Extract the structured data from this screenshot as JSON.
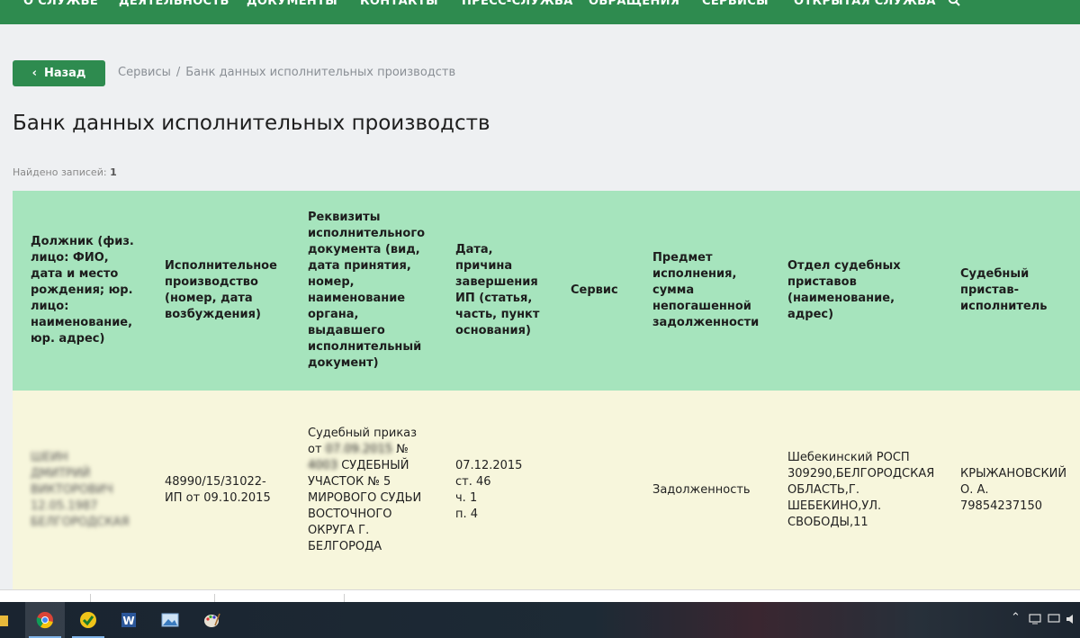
{
  "nav": {
    "items": [
      "О СЛУЖБЕ",
      "ДЕЯТЕЛЬНОСТЬ",
      "ДОКУМЕНТЫ",
      "КОНТАКТЫ",
      "ПРЕСС-СЛУЖБА",
      "ОБРАЩЕНИЯ",
      "СЕРВИСЫ",
      "ОТКРЫТАЯ СЛУЖБА"
    ],
    "search_icon": "search-icon"
  },
  "back_button": {
    "label": "Назад",
    "icon": "chevron-left-icon"
  },
  "breadcrumb": {
    "items": [
      "Сервисы",
      "Банк данных исполнительных производств"
    ],
    "separator": "/"
  },
  "page_title": "Банк данных исполнительных производств",
  "found": {
    "label": "Найдено записей:",
    "count": "1"
  },
  "table": {
    "headers": [
      "Должник (физ. лицо: ФИО, дата и место рождения; юр. лицо: наименование, юр. адрес)",
      "Исполнительное производство (номер, дата возбуждения)",
      "Реквизиты исполнительного документа (вид, дата принятия, номер, наименование органа, выдавшего исполнительный документ)",
      "Дата, причина завершения ИП (статья, часть, пункт основания)",
      "Сервис",
      "Предмет исполнения, сумма непогашенной задолженности",
      "Отдел судебных приставов (наименование, адрес)",
      "Судебный пристав-исполнитель"
    ],
    "row": {
      "debtor_lines": [
        "ШЕИН",
        "ДМИТРИЙ",
        "ВИКТОРОВИЧ",
        "12.05.1987",
        "БЕЛГОРОДСКАЯ"
      ],
      "proceeding": "48990/15/31022-ИП от 09.10.2015",
      "document_prefix": "Судебный приказ от",
      "document_date": "07.09.2015",
      "document_number_label": "№",
      "document_number": "4003",
      "document_rest": "СУДЕБНЫЙ УЧАСТОК № 5 МИРОВОГО СУДЬИ ВОСТОЧНОГО ОКРУГА Г. БЕЛГОРОДА",
      "completion_lines": [
        "07.12.2015",
        "ст. 46",
        "ч. 1",
        "п. 4"
      ],
      "service": "",
      "subject": "Задолженность",
      "department": "Шебекинский РОСП 309290,БЕЛГОРОДСКАЯ ОБЛАСТЬ,Г. ШЕБЕКИНО,УЛ. СВОБОДЫ,11",
      "bailiff": "КРЫЖАНОВСКИЙ О. А. 79854237150"
    }
  },
  "taskbar": {
    "apps": [
      "file-explorer-icon",
      "chrome-icon",
      "antivirus-icon",
      "word-icon",
      "photo-viewer-icon",
      "paint-icon"
    ]
  },
  "colors": {
    "brand_green": "#2e8b4f",
    "header_green": "#a6e4bd",
    "row_cream": "#f7f6dc"
  }
}
